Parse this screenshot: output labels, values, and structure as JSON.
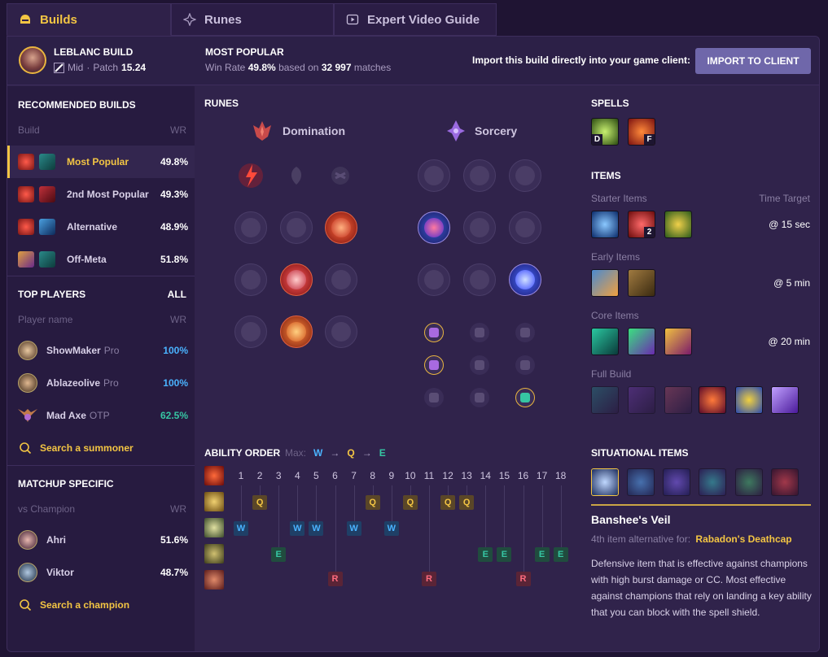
{
  "tabs": [
    {
      "label": "Builds",
      "icon": "helmet-icon",
      "active": true
    },
    {
      "label": "Runes",
      "icon": "rune-icon"
    },
    {
      "label": "Expert Video Guide",
      "icon": "video-icon"
    }
  ],
  "header": {
    "title": "LEBLANC BUILD",
    "role": "Mid",
    "patch_label": "Patch",
    "patch": "15.24",
    "most_popular_title": "MOST POPULAR",
    "wr_label": "Win Rate",
    "win_rate": "49.8%",
    "based_on": "based on",
    "matches": "32 997",
    "matches_label": "matches",
    "import_text": "Import this build directly into your game client:",
    "import_button": "IMPORT TO CLIENT"
  },
  "sidebar": {
    "recommended_title": "RECOMMENDED BUILDS",
    "build_col": "Build",
    "wr_col": "WR",
    "builds": [
      {
        "label": "Most Popular",
        "wr": "49.8%"
      },
      {
        "label": "2nd Most Popular",
        "wr": "49.3%"
      },
      {
        "label": "Alternative",
        "wr": "48.9%"
      },
      {
        "label": "Off-Meta",
        "wr": "51.8%"
      }
    ],
    "top_players_title": "TOP PLAYERS",
    "all_label": "ALL",
    "player_col": "Player name",
    "players": [
      {
        "name": "ShowMaker",
        "tag": "Pro",
        "wr": "100%"
      },
      {
        "name": "Ablazeolive",
        "tag": "Pro",
        "wr": "100%"
      },
      {
        "name": "Mad Axe",
        "tag": "OTP",
        "wr": "62.5%"
      }
    ],
    "search_summoner": "Search a summoner",
    "matchup_title": "MATCHUP SPECIFIC",
    "vs_col": "vs Champion",
    "matchups": [
      {
        "name": "Ahri",
        "wr": "51.6%"
      },
      {
        "name": "Viktor",
        "wr": "48.7%"
      }
    ],
    "search_champion": "Search a champion"
  },
  "runes": {
    "title": "RUNES",
    "primary_tree": "Domination",
    "secondary_tree": "Sorcery"
  },
  "spells": {
    "title": "SPELLS",
    "keys": [
      "D",
      "F"
    ]
  },
  "items": {
    "title": "ITEMS",
    "time_target_label": "Time Target",
    "starter_label": "Starter Items",
    "starter_time": "@ 15 sec",
    "starter_count_badge": "2",
    "early_label": "Early Items",
    "early_time": "@ 5 min",
    "core_label": "Core Items",
    "core_time": "@ 20 min",
    "full_label": "Full Build"
  },
  "ability": {
    "title": "ABILITY ORDER",
    "max_label": "Max:",
    "max_order": [
      "W",
      "Q",
      "E"
    ],
    "arrow": "→",
    "levels": [
      "1",
      "2",
      "3",
      "4",
      "5",
      "6",
      "7",
      "8",
      "9",
      "10",
      "11",
      "12",
      "13",
      "14",
      "15",
      "16",
      "17",
      "18"
    ],
    "q_levels": [
      2,
      8,
      10,
      12,
      13
    ],
    "w_levels": [
      1,
      4,
      5,
      7,
      9
    ],
    "e_levels": [
      3,
      14,
      15,
      17,
      18
    ],
    "r_levels": [
      6,
      11,
      16
    ]
  },
  "situational": {
    "title": "SITUATIONAL ITEMS",
    "item_name": "Banshee's Veil",
    "alt_label": "4th item alternative for:",
    "alt_item": "Rabadon's Deathcap",
    "description": "Defensive item that is effective against champions with high burst damage or CC. Most effective against champions that rely on landing a key ability that you can block with the spell shield."
  },
  "colors": {
    "accent": "#f3c543",
    "background": "#30234b",
    "sidebar": "#271b40",
    "button": "#6f67aa",
    "q": "#f3c543",
    "w": "#4ab3ff",
    "e": "#36c6a3",
    "r": "#ff6b7e"
  }
}
